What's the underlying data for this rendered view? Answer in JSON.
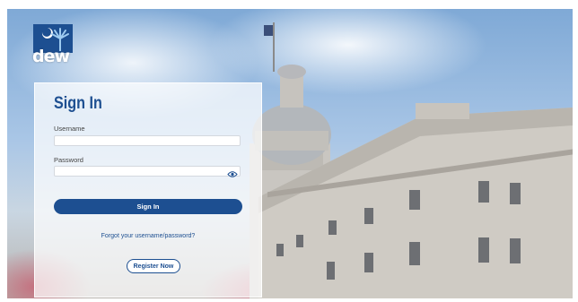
{
  "brand": {
    "logo_text": "dew",
    "primary_color": "#1d4f91"
  },
  "login": {
    "title": "Sign In",
    "username_label": "Username",
    "username_value": "",
    "password_label": "Password",
    "password_value": "",
    "show_password_icon": "eye-icon",
    "submit_label": "Sign In",
    "forgot_link": "Forgot your username/password?",
    "register_label": "Register Now"
  }
}
